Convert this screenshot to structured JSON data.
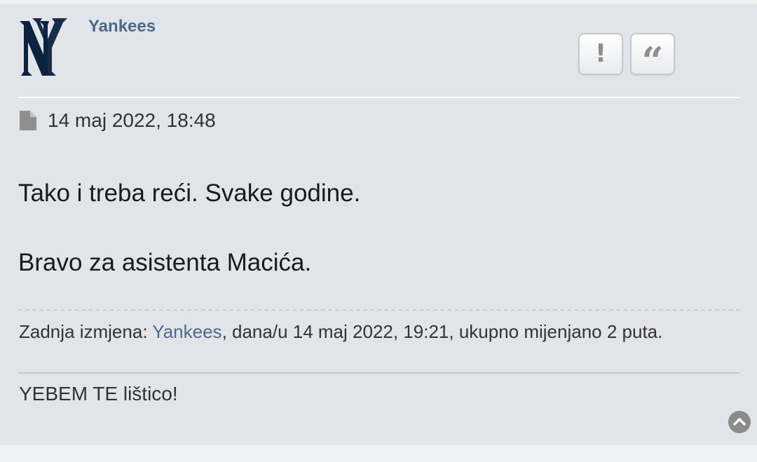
{
  "post": {
    "author": {
      "name": "Yankees",
      "avatar_icon": "ny-yankees-logo-icon",
      "avatar_color": "#0c2340"
    },
    "actions": [
      {
        "label": "!",
        "icon": "report-icon"
      },
      {
        "label": "“",
        "icon": "quote-icon"
      }
    ],
    "meta": {
      "icon": "post-file-icon",
      "timestamp": "14 maj 2022, 18:48"
    },
    "body": {
      "paragraphs": [
        "Tako i treba reći. Svake godine.",
        "Bravo za asistenta Macića."
      ]
    },
    "edit_notice": {
      "prefix": "Zadnja izmjena: ",
      "editor": "Yankees",
      "suffix": ", dana/u 14 maj 2022, 19:21, ukupno mijenjano 2 puta."
    },
    "signature": "YEBEM TE lištico!",
    "back_to_top_icon": "chevron-up-circle-icon"
  },
  "colors": {
    "post_background": "#e1e4e8",
    "username_link": "#4c6b8a",
    "text": "#333333",
    "icon_gray": "#8f8f8f"
  }
}
